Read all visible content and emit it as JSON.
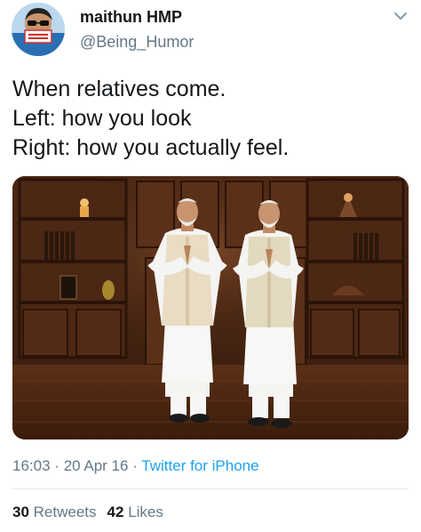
{
  "user": {
    "display_name": "maithun HMP",
    "handle": "@Being_Humor",
    "avatar_icon": "profile-avatar-icon"
  },
  "menu_icon": "chevron-down-icon",
  "tweet": {
    "lines": [
      "When relatives come.",
      "Left: how you look",
      "Right: how you actually feel."
    ]
  },
  "meta": {
    "time": "16:03",
    "date": "20 Apr 16",
    "separator": "·",
    "source": "Twitter for iPhone"
  },
  "stats": {
    "retweets_count": "30",
    "retweets_label": "Retweets",
    "likes_count": "42",
    "likes_label": "Likes"
  },
  "colors": {
    "text": "#14171a",
    "secondary": "#657786",
    "link": "#1da1f2",
    "divider": "#e1e8ed"
  }
}
